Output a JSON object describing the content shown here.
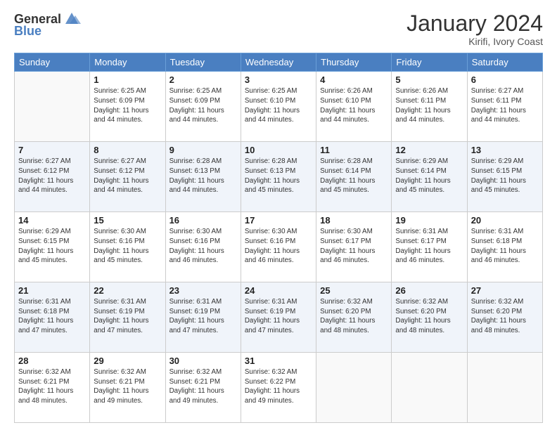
{
  "logo": {
    "line1": "General",
    "line2": "Blue"
  },
  "title": "January 2024",
  "subtitle": "Kirifi, Ivory Coast",
  "days_of_week": [
    "Sunday",
    "Monday",
    "Tuesday",
    "Wednesday",
    "Thursday",
    "Friday",
    "Saturday"
  ],
  "weeks": [
    [
      {
        "num": "",
        "info": ""
      },
      {
        "num": "1",
        "info": "Sunrise: 6:25 AM\nSunset: 6:09 PM\nDaylight: 11 hours\nand 44 minutes."
      },
      {
        "num": "2",
        "info": "Sunrise: 6:25 AM\nSunset: 6:09 PM\nDaylight: 11 hours\nand 44 minutes."
      },
      {
        "num": "3",
        "info": "Sunrise: 6:25 AM\nSunset: 6:10 PM\nDaylight: 11 hours\nand 44 minutes."
      },
      {
        "num": "4",
        "info": "Sunrise: 6:26 AM\nSunset: 6:10 PM\nDaylight: 11 hours\nand 44 minutes."
      },
      {
        "num": "5",
        "info": "Sunrise: 6:26 AM\nSunset: 6:11 PM\nDaylight: 11 hours\nand 44 minutes."
      },
      {
        "num": "6",
        "info": "Sunrise: 6:27 AM\nSunset: 6:11 PM\nDaylight: 11 hours\nand 44 minutes."
      }
    ],
    [
      {
        "num": "7",
        "info": "Sunrise: 6:27 AM\nSunset: 6:12 PM\nDaylight: 11 hours\nand 44 minutes."
      },
      {
        "num": "8",
        "info": "Sunrise: 6:27 AM\nSunset: 6:12 PM\nDaylight: 11 hours\nand 44 minutes."
      },
      {
        "num": "9",
        "info": "Sunrise: 6:28 AM\nSunset: 6:13 PM\nDaylight: 11 hours\nand 44 minutes."
      },
      {
        "num": "10",
        "info": "Sunrise: 6:28 AM\nSunset: 6:13 PM\nDaylight: 11 hours\nand 45 minutes."
      },
      {
        "num": "11",
        "info": "Sunrise: 6:28 AM\nSunset: 6:14 PM\nDaylight: 11 hours\nand 45 minutes."
      },
      {
        "num": "12",
        "info": "Sunrise: 6:29 AM\nSunset: 6:14 PM\nDaylight: 11 hours\nand 45 minutes."
      },
      {
        "num": "13",
        "info": "Sunrise: 6:29 AM\nSunset: 6:15 PM\nDaylight: 11 hours\nand 45 minutes."
      }
    ],
    [
      {
        "num": "14",
        "info": "Sunrise: 6:29 AM\nSunset: 6:15 PM\nDaylight: 11 hours\nand 45 minutes."
      },
      {
        "num": "15",
        "info": "Sunrise: 6:30 AM\nSunset: 6:16 PM\nDaylight: 11 hours\nand 45 minutes."
      },
      {
        "num": "16",
        "info": "Sunrise: 6:30 AM\nSunset: 6:16 PM\nDaylight: 11 hours\nand 46 minutes."
      },
      {
        "num": "17",
        "info": "Sunrise: 6:30 AM\nSunset: 6:16 PM\nDaylight: 11 hours\nand 46 minutes."
      },
      {
        "num": "18",
        "info": "Sunrise: 6:30 AM\nSunset: 6:17 PM\nDaylight: 11 hours\nand 46 minutes."
      },
      {
        "num": "19",
        "info": "Sunrise: 6:31 AM\nSunset: 6:17 PM\nDaylight: 11 hours\nand 46 minutes."
      },
      {
        "num": "20",
        "info": "Sunrise: 6:31 AM\nSunset: 6:18 PM\nDaylight: 11 hours\nand 46 minutes."
      }
    ],
    [
      {
        "num": "21",
        "info": "Sunrise: 6:31 AM\nSunset: 6:18 PM\nDaylight: 11 hours\nand 47 minutes."
      },
      {
        "num": "22",
        "info": "Sunrise: 6:31 AM\nSunset: 6:19 PM\nDaylight: 11 hours\nand 47 minutes."
      },
      {
        "num": "23",
        "info": "Sunrise: 6:31 AM\nSunset: 6:19 PM\nDaylight: 11 hours\nand 47 minutes."
      },
      {
        "num": "24",
        "info": "Sunrise: 6:31 AM\nSunset: 6:19 PM\nDaylight: 11 hours\nand 47 minutes."
      },
      {
        "num": "25",
        "info": "Sunrise: 6:32 AM\nSunset: 6:20 PM\nDaylight: 11 hours\nand 48 minutes."
      },
      {
        "num": "26",
        "info": "Sunrise: 6:32 AM\nSunset: 6:20 PM\nDaylight: 11 hours\nand 48 minutes."
      },
      {
        "num": "27",
        "info": "Sunrise: 6:32 AM\nSunset: 6:20 PM\nDaylight: 11 hours\nand 48 minutes."
      }
    ],
    [
      {
        "num": "28",
        "info": "Sunrise: 6:32 AM\nSunset: 6:21 PM\nDaylight: 11 hours\nand 48 minutes."
      },
      {
        "num": "29",
        "info": "Sunrise: 6:32 AM\nSunset: 6:21 PM\nDaylight: 11 hours\nand 49 minutes."
      },
      {
        "num": "30",
        "info": "Sunrise: 6:32 AM\nSunset: 6:21 PM\nDaylight: 11 hours\nand 49 minutes."
      },
      {
        "num": "31",
        "info": "Sunrise: 6:32 AM\nSunset: 6:22 PM\nDaylight: 11 hours\nand 49 minutes."
      },
      {
        "num": "",
        "info": ""
      },
      {
        "num": "",
        "info": ""
      },
      {
        "num": "",
        "info": ""
      }
    ]
  ]
}
